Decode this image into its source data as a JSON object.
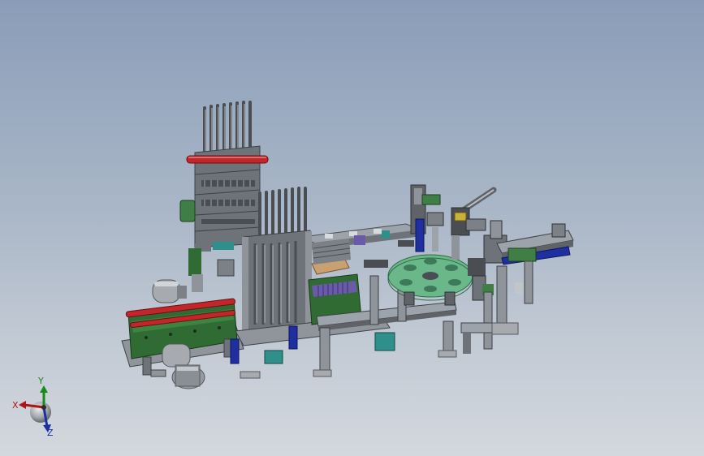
{
  "window": {
    "title": ""
  },
  "model": {
    "description_icon": "cad-assembly-icon",
    "colors": {
      "frame": "#5f6368",
      "frame_light": "#8e949a",
      "rail_red": "#c0262a",
      "guard_green": "#2f6b33",
      "plate_green": "#6ab88a",
      "base_blue": "#1f2fa0",
      "motor_grey": "#a7abb0",
      "teal": "#2f8f8a",
      "tan": "#c9a070",
      "purple": "#6b5aa8"
    }
  },
  "triad": {
    "icon": "coordinate-triad-icon",
    "x_label": "X",
    "y_label": "Y",
    "z_label": "Z",
    "colors": {
      "x": "#b01515",
      "y": "#178a1c",
      "z": "#1b2ea6"
    }
  }
}
